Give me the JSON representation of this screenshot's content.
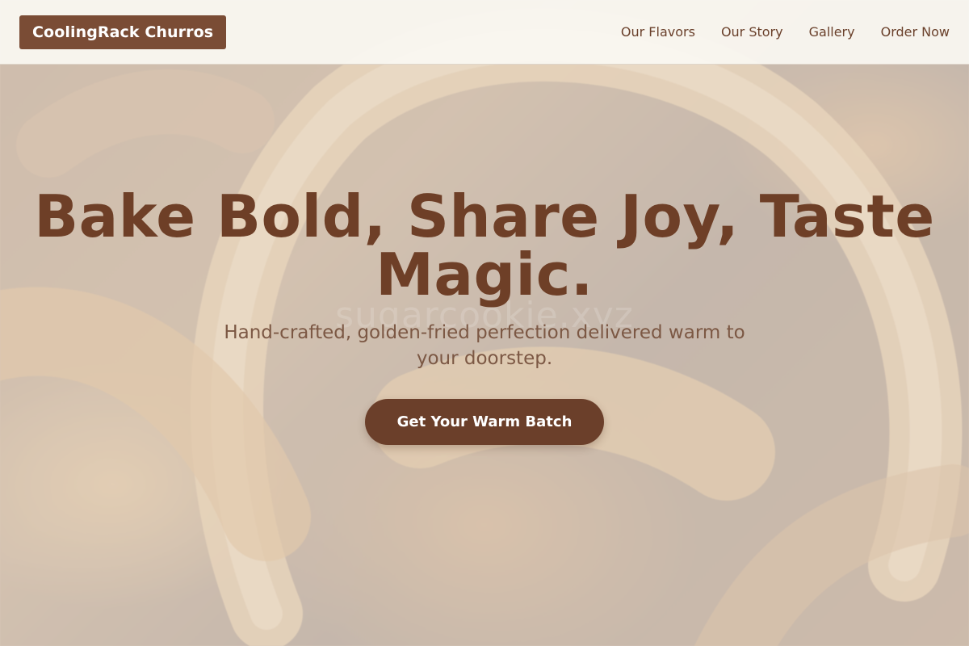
{
  "header": {
    "brand": "CoolingRack Churros",
    "nav": [
      {
        "label": "Our Flavors"
      },
      {
        "label": "Our Story"
      },
      {
        "label": "Gallery"
      },
      {
        "label": "Order Now"
      }
    ]
  },
  "hero": {
    "title": "Bake Bold, Share Joy, Taste Magic.",
    "subtitle": "Hand-crafted, golden-fried perfection delivered warm to your doorstep.",
    "cta_label": "Get Your Warm Batch",
    "watermark": "sugarcookie.xyz",
    "background_icon": "churro-photo"
  },
  "colors": {
    "brand_bg": "#7a4c35",
    "title": "#6e3f27",
    "subtitle": "#7c5844",
    "cta_bg": "#6b3f2a",
    "nav_link": "#6a402b",
    "header_bg": "#faf7f2"
  }
}
